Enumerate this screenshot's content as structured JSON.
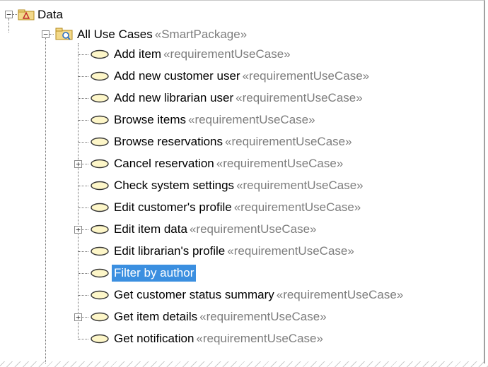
{
  "tree": {
    "root": {
      "label": "Data",
      "expanded": true
    },
    "package": {
      "label": "All Use Cases",
      "stereotype": "«SmartPackage»",
      "expanded": true
    },
    "items": [
      {
        "label": "Add item",
        "stereotype": "«requirementUseCase»",
        "expandable": false,
        "selected": false
      },
      {
        "label": "Add new  customer user",
        "stereotype": "«requirementUseCase»",
        "expandable": false,
        "selected": false
      },
      {
        "label": "Add new  librarian user",
        "stereotype": "«requirementUseCase»",
        "expandable": false,
        "selected": false
      },
      {
        "label": "Browse items",
        "stereotype": "«requirementUseCase»",
        "expandable": false,
        "selected": false
      },
      {
        "label": "Browse reservations",
        "stereotype": "«requirementUseCase»",
        "expandable": false,
        "selected": false
      },
      {
        "label": "Cancel reservation",
        "stereotype": "«requirementUseCase»",
        "expandable": true,
        "selected": false
      },
      {
        "label": "Check  system settings",
        "stereotype": "«requirementUseCase»",
        "expandable": false,
        "selected": false
      },
      {
        "label": "Edit customer's  profile",
        "stereotype": "«requirementUseCase»",
        "expandable": false,
        "selected": false
      },
      {
        "label": "Edit item data",
        "stereotype": "«requirementUseCase»",
        "expandable": true,
        "selected": false
      },
      {
        "label": "Edit librarian's  profile",
        "stereotype": "«requirementUseCase»",
        "expandable": false,
        "selected": false
      },
      {
        "label": "Filter by author",
        "stereotype": "",
        "expandable": false,
        "selected": true
      },
      {
        "label": "Get customer status summary",
        "stereotype": "«requirementUseCase»",
        "expandable": false,
        "selected": false
      },
      {
        "label": "Get item details",
        "stereotype": "«requirementUseCase»",
        "expandable": true,
        "selected": false
      },
      {
        "label": "Get notification",
        "stereotype": "«requirementUseCase»",
        "expandable": false,
        "selected": false
      }
    ]
  },
  "colors": {
    "selection": "#3b8fe0",
    "stereotype_text": "#7d7d7d",
    "package_folder": "#f3d98a",
    "use_case_icon_fill": "#fdf6c8"
  },
  "icons": {
    "expander_expanded": "−",
    "expander_collapsed": "+",
    "root_icon": "package-icon",
    "smart_package_icon": "smart-package-icon",
    "item_icon": "use-case-icon"
  }
}
